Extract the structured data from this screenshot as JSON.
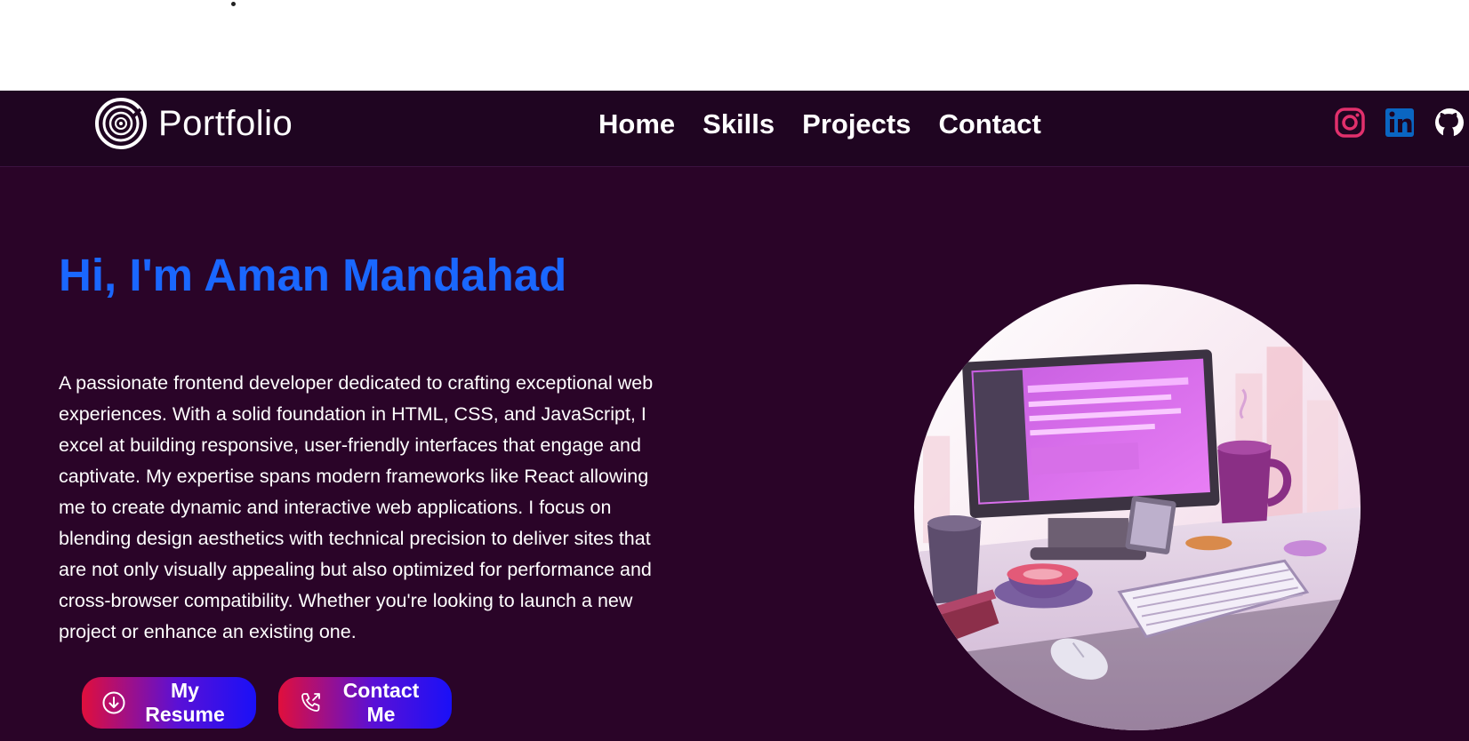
{
  "brand": {
    "name": "Portfolio",
    "logo_icon": "spiral-logo-icon"
  },
  "nav": {
    "links": [
      {
        "label": "Home"
      },
      {
        "label": "Skills"
      },
      {
        "label": "Projects"
      },
      {
        "label": "Contact"
      }
    ]
  },
  "socials": [
    {
      "name": "instagram-icon",
      "color": "#e1306c"
    },
    {
      "name": "linkedin-icon",
      "color": "#0a66c2"
    },
    {
      "name": "github-icon",
      "color": "#ffffff"
    }
  ],
  "hero": {
    "title": "Hi, I'm Aman Mandahad",
    "description": "A passionate frontend developer dedicated to crafting exceptional web experiences. With a solid foundation in HTML, CSS, and JavaScript, I excel at building responsive, user-friendly interfaces that engage and captivate. My expertise spans modern frameworks like React allowing me to create dynamic and interactive web applications. I focus on blending design aesthetics with technical precision to deliver sites that are not only visually appealing but also optimized for performance and cross-browser compatibility. Whether you're looking to launch a new project or enhance an existing one.",
    "buttons": {
      "resume": {
        "label": "My Resume",
        "icon": "download-circle-icon"
      },
      "contact": {
        "label": "Contact Me",
        "icon": "phone-outgoing-icon"
      }
    },
    "illustration": "desk-computer-illustration"
  },
  "colors": {
    "navbar_bg": "#1f0521",
    "hero_bg": "#2a0428",
    "title": "#1a67ff",
    "button_gradient": [
      "#e00f3c",
      "#1a10f7"
    ]
  }
}
